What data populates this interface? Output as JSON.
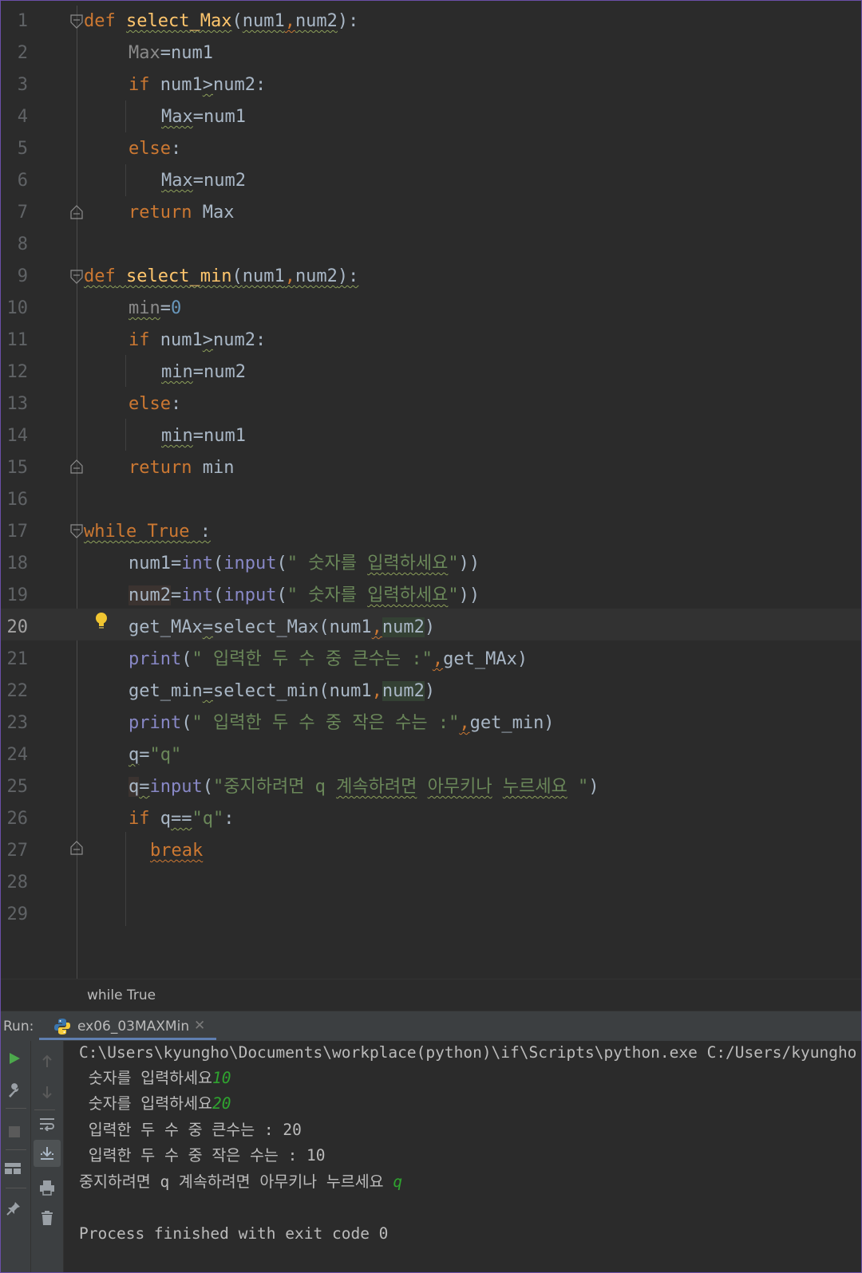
{
  "editor": {
    "lines": [
      {
        "n": "1"
      },
      {
        "n": "2"
      },
      {
        "n": "3"
      },
      {
        "n": "4"
      },
      {
        "n": "5"
      },
      {
        "n": "6"
      },
      {
        "n": "7"
      },
      {
        "n": "8"
      },
      {
        "n": "9"
      },
      {
        "n": "10"
      },
      {
        "n": "11"
      },
      {
        "n": "12"
      },
      {
        "n": "13"
      },
      {
        "n": "14"
      },
      {
        "n": "15"
      },
      {
        "n": "16"
      },
      {
        "n": "17"
      },
      {
        "n": "18"
      },
      {
        "n": "19"
      },
      {
        "n": "20"
      },
      {
        "n": "21"
      },
      {
        "n": "22"
      },
      {
        "n": "23"
      },
      {
        "n": "24"
      },
      {
        "n": "25"
      },
      {
        "n": "26"
      },
      {
        "n": "27"
      },
      {
        "n": "28"
      },
      {
        "n": "29"
      }
    ],
    "current_line": "20",
    "code": {
      "l1": {
        "def": "def",
        "name": "select_Max",
        "open": "(",
        "p1": "num1",
        "comma": ",",
        "p2": "num2",
        "close": "):"
      },
      "l2": {
        "var": "Max",
        "rest": "=num1"
      },
      "l3": {
        "kw": "if",
        "a": " num1",
        "op": ">",
        "b": "num2:"
      },
      "l4": {
        "var": "Max",
        "rest": "=num1"
      },
      "l5": {
        "kw": "else",
        "colon": ":"
      },
      "l6": {
        "var": "Max",
        "rest": "=num2"
      },
      "l7": {
        "kw": "return",
        "rest": " Max"
      },
      "l9": {
        "def": "def",
        "name": "select_min",
        "open": "(",
        "p1": "num1",
        "comma": ",",
        "p2": "num2",
        "close": "):"
      },
      "l10": {
        "var": "min",
        "eq": "=",
        "num": "0"
      },
      "l11": {
        "kw": "if",
        "a": " num1",
        "op": ">",
        "b": "num2:"
      },
      "l12": {
        "var": "min",
        "rest": "=num2"
      },
      "l13": {
        "kw": "else",
        "colon": ":"
      },
      "l14": {
        "var": "min",
        "rest": "=num1"
      },
      "l15": {
        "kw": "return",
        "rest": " min"
      },
      "l17": {
        "kw": "while",
        "sp": " ",
        "tr": "True",
        "rest": " :"
      },
      "l18": {
        "var": "num1",
        "eq": "=",
        "int": "int",
        "p": "(",
        "inp": "input",
        "p2": "(",
        "s1": "\" 숫자를 ",
        "s2": "입력하세요",
        "s3": "\"",
        "close": "))"
      },
      "l19": {
        "var": "num2",
        "eq": "=",
        "int": "int",
        "p": "(",
        "inp": "input",
        "p2": "(",
        "s1": "\" 숫자를 ",
        "s2": "입력하세요",
        "s3": "\"",
        "close": "))"
      },
      "l20": {
        "var": "get_MAx",
        "eq": "=",
        "fn": "select_Max(num1",
        "comma": ",",
        "arg": "num2",
        "close": ")"
      },
      "l21": {
        "pr": "print",
        "p": "(",
        "s": "\" 입력한 두 수 중 큰수는 :\"",
        "comma": ",",
        "rest": "get_MAx)"
      },
      "l22": {
        "var": "get_min",
        "eq": "=",
        "fn": "select_min(num1",
        "comma": ",",
        "arg": "num2",
        "close": ")"
      },
      "l23": {
        "pr": "print",
        "p": "(",
        "s": "\" 입력한 두 수 중 작은 수는 :\"",
        "comma": ",",
        "rest": "get_min)"
      },
      "l24": {
        "var": "q",
        "eq": "=",
        "s": "\"q\""
      },
      "l25": {
        "var": "q",
        "eq": "=",
        "inp": "input",
        "p": "(",
        "s1": "\"중지하려면 q ",
        "s2": "계속하려면",
        "s3": " ",
        "s4": "아무키나",
        "s5": " ",
        "s6": "누르세요",
        "s7": " \"",
        "close": ")"
      },
      "l26": {
        "kw": "if",
        "a": " q",
        "op": "==",
        "s": "\"q\"",
        "colon": ":"
      },
      "l27": {
        "kw": "break"
      }
    }
  },
  "breadcrumb": {
    "text": "while True"
  },
  "run": {
    "label": "Run:",
    "tab": "ex06_03MAXMin",
    "close": "✕",
    "console": [
      {
        "text": "C:\\Users\\kyungho\\Documents\\workplace(python)\\if\\Scripts\\python.exe C:/Users/kyungho",
        "input": ""
      },
      {
        "text": " 숫자를 입력하세요",
        "input": "10"
      },
      {
        "text": " 숫자를 입력하세요",
        "input": "20"
      },
      {
        "text": " 입력한 두 수 중 큰수는 : 20",
        "input": ""
      },
      {
        "text": " 입력한 두 수 중 작은 수는 : 10",
        "input": ""
      },
      {
        "text": "중지하려면 q 계속하려면 아무키나 누르세요 ",
        "input": "q"
      },
      {
        "text": "",
        "input": ""
      },
      {
        "text": "Process finished with exit code 0",
        "input": ""
      }
    ]
  },
  "colors": {
    "keyword": "#cc7832",
    "function": "#ffc66d",
    "string": "#6a8759",
    "number": "#6897bb",
    "builtin": "#8888c6",
    "text": "#a9b7c6",
    "console_input": "#2fa42f"
  }
}
